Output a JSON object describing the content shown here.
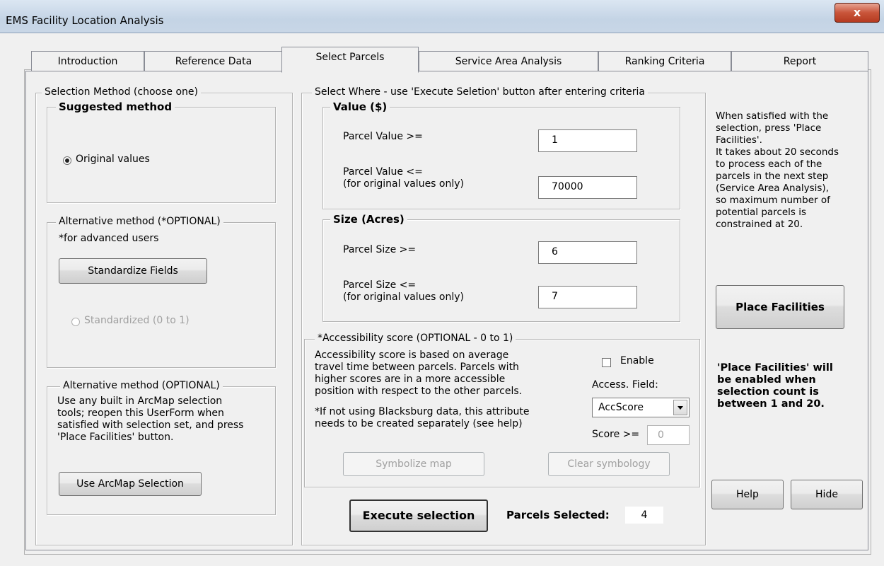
{
  "window": {
    "title": "EMS Facility Location Analysis",
    "close_label": "x"
  },
  "tabs": [
    {
      "label": "Introduction"
    },
    {
      "label": "Reference Data"
    },
    {
      "label": "Select Parcels",
      "active": true
    },
    {
      "label": "Service Area Analysis"
    },
    {
      "label": "Ranking Criteria"
    },
    {
      "label": "Report"
    }
  ],
  "selection_method": {
    "legend": "Selection Method (choose one)",
    "suggested": {
      "legend": "Suggested method",
      "radio_label": "Original values",
      "selected": true
    },
    "alternative1": {
      "legend": "Alternative method (*OPTIONAL)",
      "note": "*for advanced users",
      "button_label": "Standardize Fields",
      "radio_label": "Standardized (0 to 1)",
      "radio_enabled": false
    },
    "alternative2": {
      "legend": "Alternative method (OPTIONAL)",
      "lines": [
        "Use any built in ArcMap selection",
        "tools; reopen this UserForm when",
        "satisfied with selection set, and press",
        "'Place Facilities' button."
      ],
      "button_label": "Use ArcMap Selection"
    }
  },
  "select_where": {
    "legend": "Select Where - use 'Execute Seletion' button after entering criteria",
    "value": {
      "legend": "Value ($)",
      "min_label": "Parcel Value >=",
      "min_value": "1",
      "max_label_1": "Parcel Value <=",
      "max_label_2": "(for original values only)",
      "max_value": "70000"
    },
    "size": {
      "legend": "Size (Acres)",
      "min_label": "Parcel Size >=",
      "min_value": "6",
      "max_label_1": "Parcel Size <=",
      "max_label_2": "(for original values only)",
      "max_value": "7"
    },
    "accessibility": {
      "legend": "*Accessibility score (OPTIONAL - 0 to 1)",
      "lines": [
        "Accessibility score is based on average",
        "travel time between parcels. Parcels with",
        "higher scores are in a more accessible",
        "position with respect to the other parcels."
      ],
      "note_lines": [
        "*If not using Blacksburg data, this attribute",
        "needs to be created separately (see help)"
      ],
      "enable_label": "Enable",
      "enabled": false,
      "field_label": "Access. Field:",
      "field_value": "AccScore",
      "score_label": "Score >=",
      "score_value": "0",
      "symbolize_label": "Symbolize map",
      "clear_label": "Clear symbology"
    },
    "execute_label": "Execute selection",
    "selected_label": "Parcels Selected:",
    "selected_count": "4"
  },
  "right_panel": {
    "info_lines": [
      "When satisfied with the",
      "selection, press 'Place",
      "Facilities'.",
      "It takes about 20 seconds",
      "to process each of the",
      "parcels in the next step",
      "(Service Area Analysis),",
      "so maximum number of",
      "potential parcels is",
      "constrained at 20."
    ],
    "place_label": "Place Facilities",
    "note_lines": [
      "'Place Facilities' will",
      "be enabled when",
      "selection count is",
      "between 1 and 20."
    ],
    "help_label": "Help",
    "hide_label": "Hide"
  }
}
